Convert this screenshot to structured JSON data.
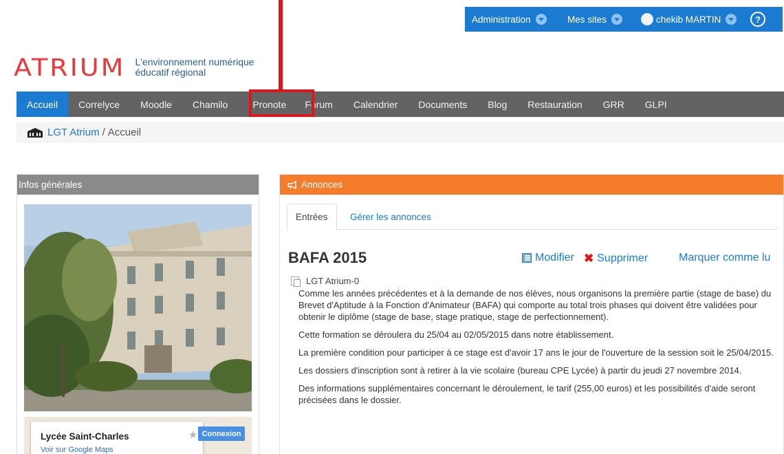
{
  "topbar": {
    "admin_label": "Administration",
    "sites_label": "Mes sites",
    "user_label": "chekib MARTIN",
    "help_label": "?"
  },
  "logo": {
    "word": "ATRIUM",
    "tagline_line1": "L'environnement numérique",
    "tagline_line2": "éducatif régional"
  },
  "nav": {
    "items": [
      {
        "label": "Accueil"
      },
      {
        "label": "Correlyce"
      },
      {
        "label": "Moodle"
      },
      {
        "label": "Chamilo"
      },
      {
        "label": "Pronote"
      },
      {
        "label": "Forum"
      },
      {
        "label": "Calendrier"
      },
      {
        "label": "Documents"
      },
      {
        "label": "Blog"
      },
      {
        "label": "Restauration"
      },
      {
        "label": "GRR"
      },
      {
        "label": "GLPI"
      }
    ],
    "active_index": 0,
    "highlighted_item": "Pronote"
  },
  "breadcrumb": {
    "link": "LGT Atrium",
    "separator": "/",
    "current": "Accueil"
  },
  "left_panel": {
    "title": "Infos générales",
    "map": {
      "place_name": "Lycée Saint-Charles",
      "maps_link": "Voir sur Google Maps",
      "connect_label": "Connexion"
    }
  },
  "announcements": {
    "title": "Annonces",
    "tabs": [
      "Entrées",
      "Gérer les annonces"
    ],
    "active_tab_index": 0,
    "post": {
      "title": "BAFA 2015",
      "edit_label": "Modifier",
      "delete_label": "Supprimer",
      "mark_label": "Marquer comme lu",
      "source": "LGT Atrium-0",
      "paragraphs": [
        "Comme les années précédentes et à la demande de nos élèves, nous organisons la première partie (stage de base) du Brevet d'Aptitude à la Fonction d'Animateur (BAFA) qui comporte au total trois phases qui doivent être validées pour obtenir le diplôme (stage de base, stage pratique, stage de perfectionnement).",
        "Cette formation se déroulera du 25/04 au 02/05/2015 dans notre établissement.",
        "La première condition pour participer à ce stage est d'avoir 17 ans le jour de l'ouverture de la session soit le 25/04/2015.",
        "Les dossiers d'inscription sont à retirer à la vie scolaire (bureau CPE Lycée) à partir du jeudi 27 novembre 2014.",
        "Des informations supplémentaires concernant le déroulement, le tarif (255,00 euros) et les possibilités d'aide seront précisées dans le dossier."
      ]
    }
  },
  "colors": {
    "brand_blue": "#1a7bd0",
    "nav_gray": "#636363",
    "logo_red": "#e8393c",
    "announce_orange": "#f47c2a",
    "annotation_red": "#e0141b"
  }
}
